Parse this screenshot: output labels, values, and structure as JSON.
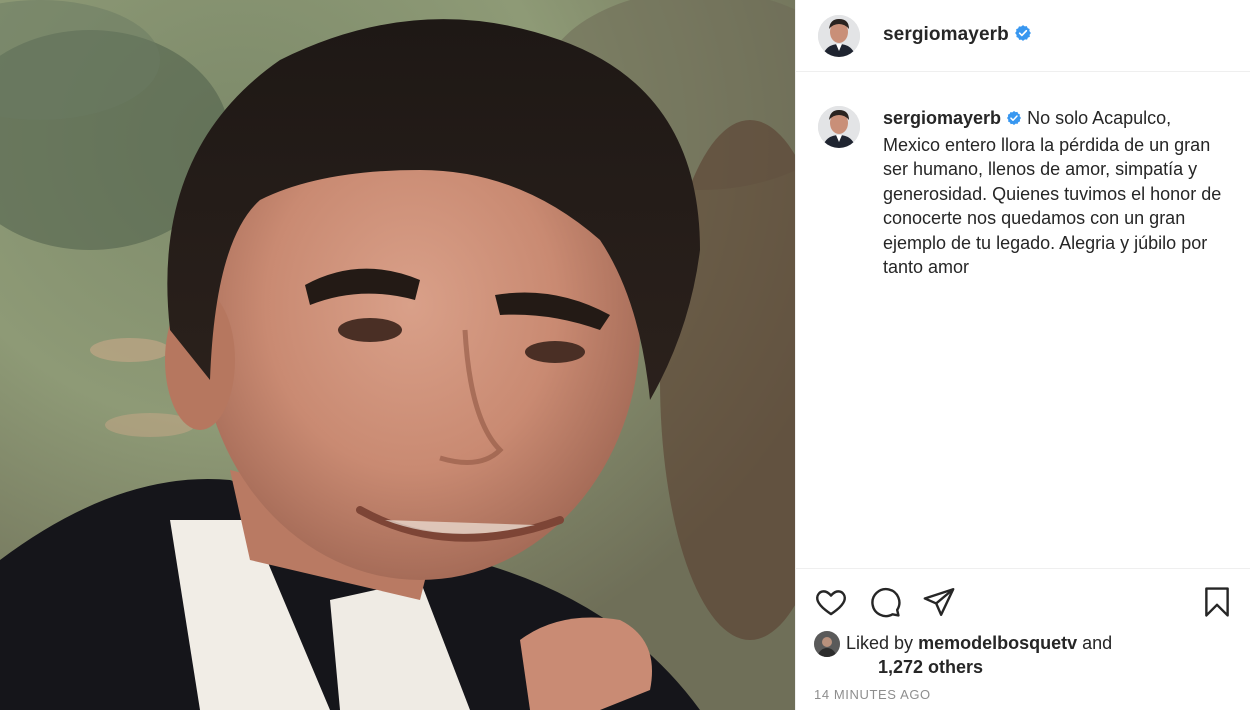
{
  "post": {
    "photo_alt": "",
    "author": {
      "username": "sergiomayerb",
      "verified": true
    },
    "caption": {
      "username": "sergiomayerb",
      "text": "No solo Acapulco, Mexico entero llora la pérdida de un gran ser humano, llenos de amor, simpatía y generosidad. Quienes tuvimos el honor de conocerte nos quedamos con un gran ejemplo de tu legado. Alegria y júbilo por tanto amor"
    },
    "actions": {
      "like_icon": "heart-outline-icon",
      "comment_icon": "comment-bubble-icon",
      "share_icon": "paper-plane-icon",
      "save_icon": "bookmark-outline-icon"
    },
    "likes": {
      "prefix": "Liked by",
      "user": "memodelbosquetv",
      "conjunction": "and",
      "others": "1,272 others"
    },
    "timestamp": "14 minutes ago"
  },
  "colors": {
    "text": "#262626",
    "muted": "#8e8e8e",
    "verified_blue": "#3897f0",
    "border": "#efefef"
  }
}
